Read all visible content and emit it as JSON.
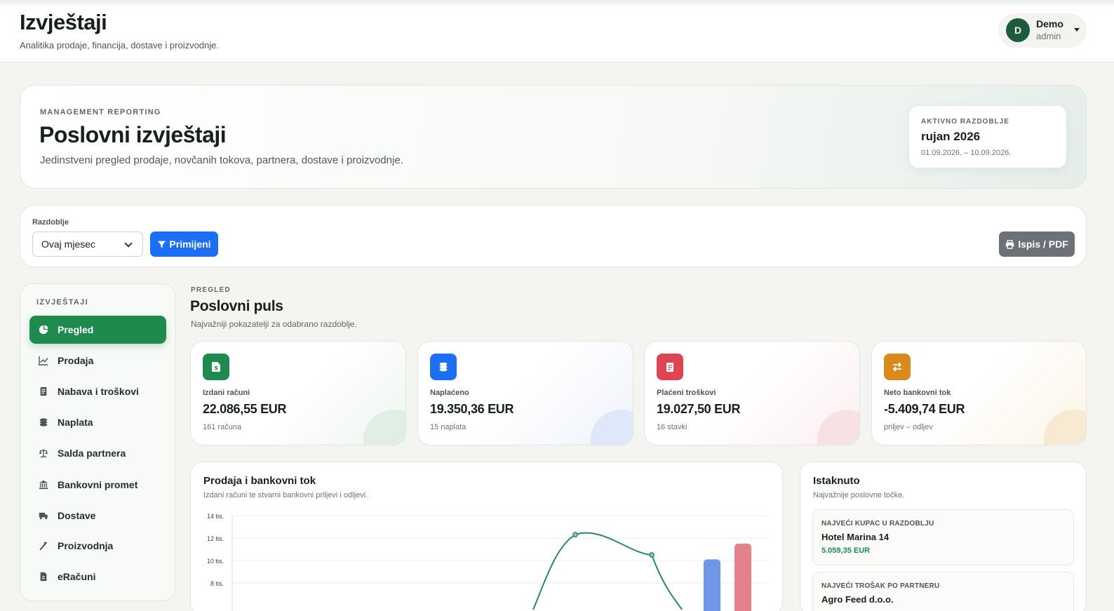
{
  "header": {
    "title": "Izvještaji",
    "subtitle": "Analitika prodaje, financija, dostave i proizvodnje.",
    "user": {
      "initial": "D",
      "name": "Demo",
      "role": "admin"
    }
  },
  "hero": {
    "eyebrow": "MANAGEMENT REPORTING",
    "title": "Poslovni izvještaji",
    "description": "Jedinstveni pregled prodaje, novčanih tokova, partnera, dostave i proizvodnje.",
    "period_label": "AKTIVNO RAZDOBLJE",
    "period_value": "rujan 2026",
    "period_range": "01.09.2026. – 10.09.2026."
  },
  "filters": {
    "label": "Razdoblje",
    "selected": "Ovaj mjesec",
    "apply_label": "Primijeni",
    "print_label": "Ispis / PDF"
  },
  "sidebar": {
    "heading": "IZVJEŠTAJI",
    "items": [
      {
        "label": "Pregled",
        "icon": "pie-chart-icon"
      },
      {
        "label": "Prodaja",
        "icon": "line-chart-icon"
      },
      {
        "label": "Nabava i troškovi",
        "icon": "receipt-icon"
      },
      {
        "label": "Naplata",
        "icon": "coins-icon"
      },
      {
        "label": "Salda partnera",
        "icon": "scale-icon"
      },
      {
        "label": "Bankovni promet",
        "icon": "bank-icon"
      },
      {
        "label": "Dostave",
        "icon": "truck-icon"
      },
      {
        "label": "Proizvodnja",
        "icon": "tool-icon"
      },
      {
        "label": "eRačuni",
        "icon": "file-icon"
      }
    ]
  },
  "overview": {
    "eyebrow": "PREGLED",
    "title": "Poslovni puls",
    "description": "Najvažniji pokazatelji za odabrano razdoblje."
  },
  "kpis": [
    {
      "label": "Izdani računi",
      "value": "22.086,55 EUR",
      "sub": "161 računa",
      "color": "#1f8a4e",
      "icon": "invoice-icon"
    },
    {
      "label": "Naplaćeno",
      "value": "19.350,36 EUR",
      "sub": "15 naplata",
      "color": "#1a6ff2",
      "icon": "coins-icon"
    },
    {
      "label": "Plaćeni troškovi",
      "value": "19.027,50 EUR",
      "sub": "16 stavki",
      "color": "#dc4553",
      "icon": "receipt-icon"
    },
    {
      "label": "Neto bankovni tok",
      "value": "-5.409,74 EUR",
      "sub": "priljev – odljev",
      "color": "#d98a1c",
      "icon": "exchange-icon"
    }
  ],
  "sales_chart": {
    "title": "Prodaja i bankovni tok",
    "description": "Izdani računi te stvarni bankovni priljevi i odljevi."
  },
  "chart_data": {
    "type": "line",
    "title": "Prodaja i bankovni tok",
    "y_tick_labels": [
      "14 tis.",
      "12 tis.",
      "10 tis.",
      "8 tis."
    ],
    "ylim": [
      8000,
      14000
    ],
    "series": [
      {
        "values_visible": [
          12300,
          10500
        ]
      }
    ],
    "bars_visible": [
      10100,
      11500
    ],
    "grid": true
  },
  "highlights": {
    "title": "Istaknuto",
    "description": "Najvažnije poslovne točke.",
    "items": [
      {
        "label": "NAJVEĆI KUPAC U RAZDOBLJU",
        "name": "Hotel Marina 14",
        "value": "5.059,35 EUR"
      },
      {
        "label": "NAJVEĆI TROŠAK PO PARTNERU",
        "name": "Agro Feed d.o.o.",
        "value": ""
      }
    ]
  },
  "colors": {
    "primary_green": "#1f8a4e",
    "blue": "#1a6ff2",
    "red": "#dc4553",
    "orange": "#d98a1c",
    "grey_button": "#6b7176"
  }
}
